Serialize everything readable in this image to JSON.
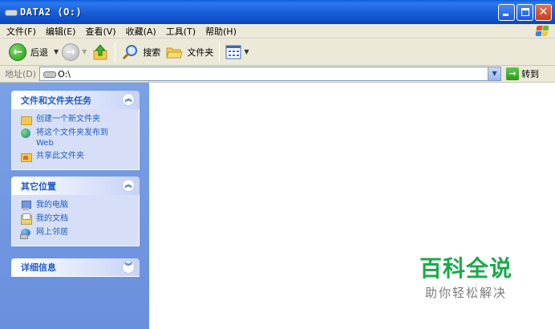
{
  "window": {
    "title": "DATA2 (O:)",
    "colors": {
      "titlebar": "#1a5fd6",
      "close": "#c8401c"
    }
  },
  "menu": {
    "items": [
      "文件(F)",
      "编辑(E)",
      "查看(V)",
      "收藏(A)",
      "工具(T)",
      "帮助(H)"
    ]
  },
  "toolbar": {
    "back_label": "后退",
    "search_label": "搜索",
    "folders_label": "文件夹"
  },
  "address": {
    "label": "地址(D)",
    "value": "O:\\",
    "go_label": "转到"
  },
  "tasks_panel": {
    "title": "文件和文件夹任务",
    "items": [
      "创建一个新文件夹",
      "将这个文件夹发布到 Web",
      "共享此文件夹"
    ]
  },
  "places_panel": {
    "title": "其它位置",
    "items": [
      "我的电脑",
      "我的文档",
      "网上邻居"
    ]
  },
  "details_panel": {
    "title": "详细信息"
  },
  "watermark": {
    "title": "百科全说",
    "subtitle": "助你轻松解决"
  }
}
